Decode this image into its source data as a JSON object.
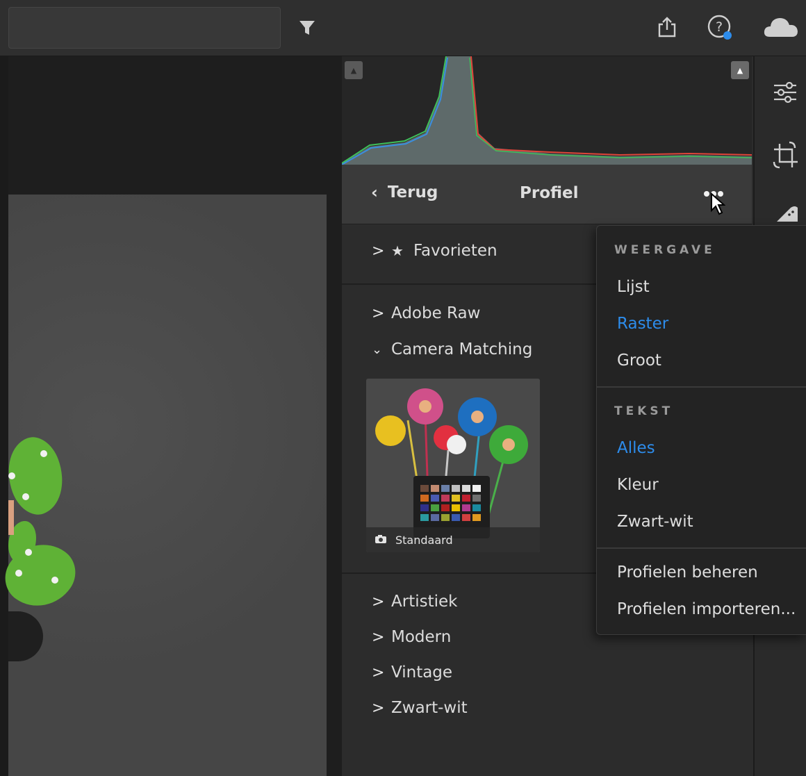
{
  "toolbar": {
    "filter_icon": "filter-icon",
    "share_icon": "share-icon",
    "help_icon": "help-icon",
    "cloud_icon": "cloud-icon"
  },
  "histogram": {
    "colors": {
      "red": "#e0453a",
      "green": "#3fbf5a",
      "blue": "#3a8fe0"
    }
  },
  "profile_panel": {
    "back_label": "Terug",
    "title": "Profiel",
    "more_icon": "more-options-icon",
    "groups": [
      {
        "label": "Favorieten",
        "expanded": false,
        "star": true
      },
      {
        "label": "Adobe Raw",
        "expanded": false
      },
      {
        "label": "Camera Matching",
        "expanded": true
      },
      {
        "label": "Artistiek",
        "expanded": false
      },
      {
        "label": "Modern",
        "expanded": false
      },
      {
        "label": "Vintage",
        "expanded": false
      },
      {
        "label": "Zwart-wit",
        "expanded": false
      }
    ],
    "thumbnail": {
      "label": "Standaard",
      "icon": "camera-icon"
    }
  },
  "menu": {
    "view_heading": "WEERGAVE",
    "view_items": [
      "Lijst",
      "Raster",
      "Groot"
    ],
    "view_selected": "Raster",
    "text_heading": "TEKST",
    "text_items": [
      "Alles",
      "Kleur",
      "Zwart-wit"
    ],
    "text_selected": "Alles",
    "actions": [
      "Profielen beheren",
      "Profielen importeren..."
    ]
  },
  "accent_color": "#2d8ceb"
}
